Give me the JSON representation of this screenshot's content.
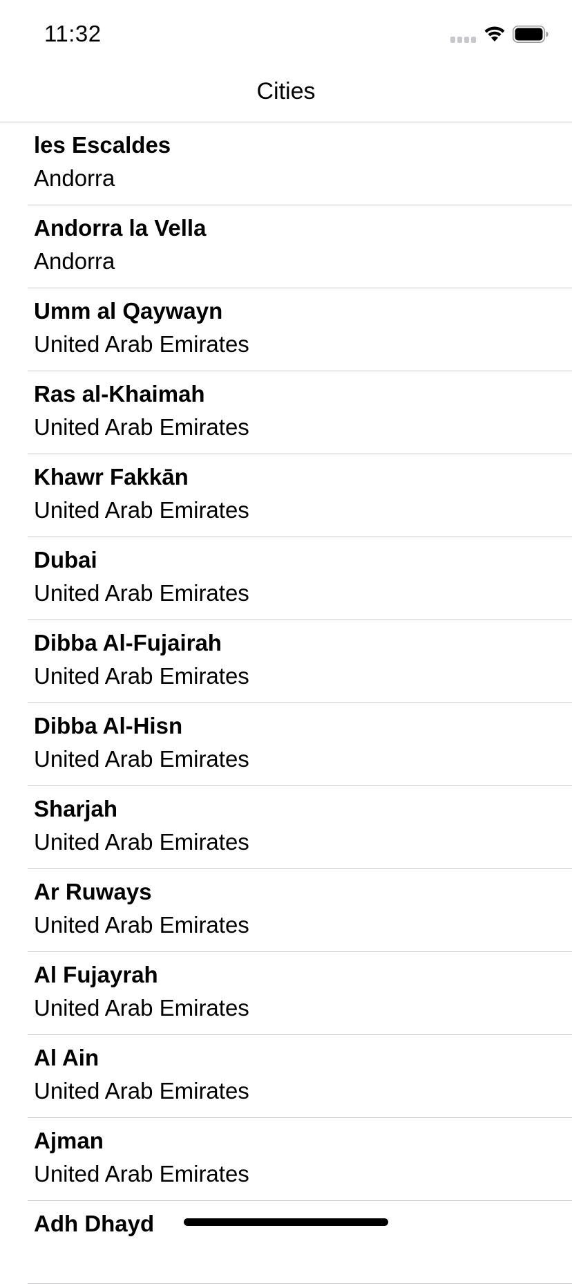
{
  "status_bar": {
    "time": "11:32",
    "icons": [
      "signal-icon",
      "wifi-icon",
      "battery-icon"
    ]
  },
  "nav": {
    "title": "Cities"
  },
  "cities": [
    {
      "name": "les Escaldes",
      "country": "Andorra"
    },
    {
      "name": "Andorra la Vella",
      "country": "Andorra"
    },
    {
      "name": "Umm al Qaywayn",
      "country": "United Arab Emirates"
    },
    {
      "name": "Ras al-Khaimah",
      "country": "United Arab Emirates"
    },
    {
      "name": "Khawr Fakkān",
      "country": "United Arab Emirates"
    },
    {
      "name": "Dubai",
      "country": "United Arab Emirates"
    },
    {
      "name": "Dibba Al-Fujairah",
      "country": "United Arab Emirates"
    },
    {
      "name": "Dibba Al-Hisn",
      "country": "United Arab Emirates"
    },
    {
      "name": "Sharjah",
      "country": "United Arab Emirates"
    },
    {
      "name": "Ar Ruways",
      "country": "United Arab Emirates"
    },
    {
      "name": "Al Fujayrah",
      "country": "United Arab Emirates"
    },
    {
      "name": "Al Ain",
      "country": "United Arab Emirates"
    },
    {
      "name": "Ajman",
      "country": "United Arab Emirates"
    },
    {
      "name": "Adh Dhayd",
      "country": ""
    }
  ],
  "colors": {
    "separator": "#c6c6c8",
    "text": "#000000",
    "background": "#ffffff"
  }
}
